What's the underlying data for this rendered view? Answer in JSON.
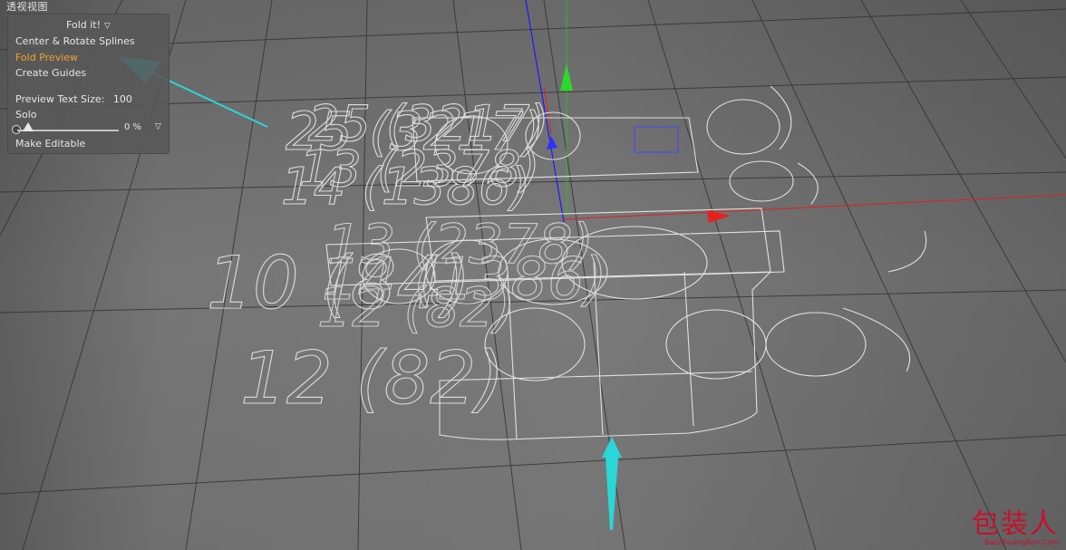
{
  "viewport": {
    "label": "透视视图",
    "text_lines": [
      "25 (3217)",
      "14 (1386)",
      "13 (2378)",
      "10 (84)",
      "12 (82)"
    ]
  },
  "panel": {
    "title": "Fold it!",
    "menu": [
      {
        "label": "Center & Rotate Splines",
        "active": false
      },
      {
        "label": "Fold Preview",
        "active": true
      },
      {
        "label": "Create Guides",
        "active": false
      }
    ],
    "preview_text_size_label": "Preview Text Size:",
    "preview_text_size_value": "100",
    "solo_label": "Solo",
    "slider_value": "0 %",
    "make_editable": "Make Editable"
  },
  "watermark": {
    "main": "包装人",
    "sub": "BaoZhuangRen.Com"
  },
  "colors": {
    "viewport_bg": "#6f6f6f",
    "grid": "#2e2e2e",
    "wire": "#dcdcdc",
    "axis_x": "#e02020",
    "axis_y": "#20c020",
    "axis_z": "#2a2aff",
    "annotation_arrow": "#2ad7d7",
    "highlight": "#f0a22a",
    "watermark": "#c8102e"
  },
  "icons": {
    "dropdown": "chevron-down-icon",
    "annotation": "arrow-icon"
  }
}
